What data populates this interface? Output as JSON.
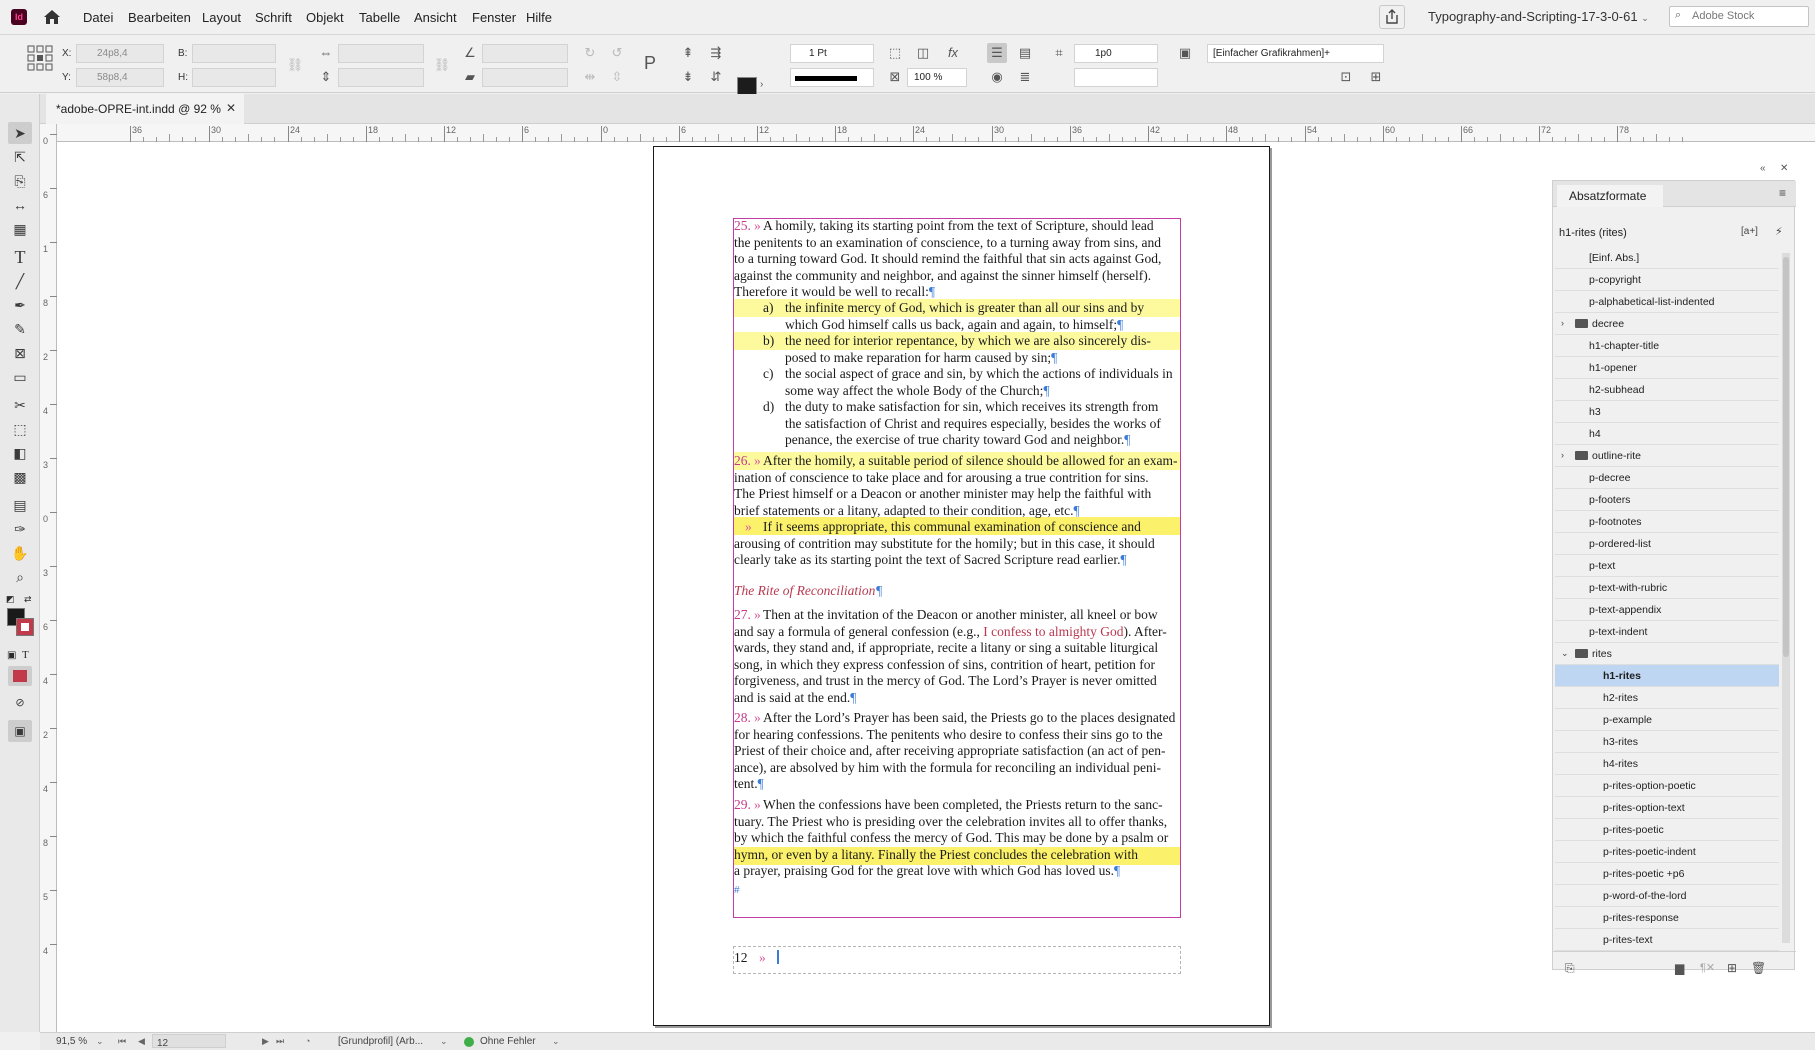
{
  "app": {
    "logo": "Id",
    "home_icon": "home-icon"
  },
  "menu": [
    "Datei",
    "Bearbeiten",
    "Layout",
    "Schrift",
    "Objekt",
    "Tabelle",
    "Ansicht",
    "Fenster",
    "Hilfe"
  ],
  "header": {
    "document_title": "Typography-and-Scripting-17-3-0-61",
    "stock_placeholder": "Adobe Stock"
  },
  "control": {
    "x_label": "X:",
    "x_value": "24p8,4",
    "y_label": "Y:",
    "y_value": "58p8,4",
    "w_label": "B:",
    "h_label": "H:",
    "stroke_weight": "1 Pt",
    "scale": "100 %",
    "spacing": "1p0",
    "object_style": "[Einfacher Grafikrahmen]+"
  },
  "tab": {
    "label": "*adobe-OPRE-int.indd @ 92 %"
  },
  "ruler": {
    "h_ticks": [
      "36",
      "30",
      "24",
      "18",
      "12",
      "6",
      "0",
      "6",
      "12",
      "18",
      "24",
      "30",
      "36",
      "42",
      "48",
      "54",
      "60",
      "66",
      "72",
      "78"
    ],
    "v_ticks": [
      "0",
      "6",
      "1",
      "8",
      "2",
      "4",
      "3",
      "0",
      "3",
      "6",
      "4",
      "2",
      "4",
      "8",
      "5",
      "4"
    ]
  },
  "document": {
    "p25_num": "25.",
    "p25_lines": [
      "A homily, taking its starting point from the text of Scripture, should lead",
      "the penitents to an examination of conscience, to a turning away from sins, and",
      "to a turning toward God. It should remind the faithful that sin acts against God,",
      "against the community and neighbor, and against the sinner himself (herself).",
      "Therefore it would be well to recall:"
    ],
    "list": [
      {
        "letter": "a)",
        "lines": [
          "the infinite mercy of God, which is greater than all our sins and by",
          "which God himself calls us back, again and again, to himself;"
        ]
      },
      {
        "letter": "b)",
        "lines": [
          "the need for interior repentance, by which we are also sincerely dis-",
          "posed to make reparation for harm caused by sin;"
        ]
      },
      {
        "letter": "c)",
        "lines": [
          "the social aspect of grace and sin, by which the actions of individuals in",
          "some way affect the whole Body of the Church;"
        ]
      },
      {
        "letter": "d)",
        "lines": [
          "the duty to make satisfaction for sin, which receives its strength from",
          "the satisfaction of Christ and requires especially, besides the works of",
          "penance, the exercise of true charity toward God and neighbor."
        ]
      }
    ],
    "p26_num": "26.",
    "p26_lines": [
      "After the homily, a suitable period of silence should be allowed for an exam-",
      "ination of conscience to take place and for arousing a true contrition for sins.",
      "The Priest himself or a Deacon or another minister may help the faithful with",
      "brief statements or a litany, adapted to their condition, age, etc."
    ],
    "p26b_lines": [
      "If it seems appropriate, this communal examination of conscience and",
      "arousing of contrition may substitute for the homily; but in this case, it should",
      "clearly take as its starting point the text of Sacred Scripture read earlier."
    ],
    "heading": "The Rite of Reconciliation",
    "p27_num": "27.",
    "p27_first": "Then at the invitation of the Deacon or another minister, all kneel or bow",
    "p27_second_a": "and say a formula of general confession (e.g., ",
    "p27_rubric": "I confess to almighty God",
    "p27_second_b": "). After-",
    "p27_lines": [
      "wards, they stand and, if appropriate, recite a litany or sing a suitable liturgical",
      "song, in which they express confession of sins, contrition of heart, petition for",
      "forgiveness, and trust in the mercy of God. The Lord’s Prayer is never omitted",
      "and is said at the end."
    ],
    "p28_num": "28.",
    "p28_lines": [
      "After the Lord’s Prayer has been said, the Priests go to the places designated",
      "for hearing confessions. The penitents who desire to confess their sins go to the",
      "Priest of their choice and, after receiving appropriate satisfaction (an act of pen-",
      "ance), are absolved by him with the formula for reconciling an individual peni-",
      "tent."
    ],
    "p29_num": "29.",
    "p29_lines": [
      "When the confessions have been completed, the Priests return to the sanc-",
      "tuary. The Priest who is presiding over the celebration invites all to offer thanks,",
      "by which the faithful confess the mercy of God. This may be done by a psalm or",
      "hymn, or even by a litany. Finally the Priest concludes the celebration with",
      "a prayer, praising God for the great love with which God has loved us."
    ],
    "pilcrow": "¶",
    "tab_mark": "»",
    "folio": "12"
  },
  "panel": {
    "title": "Absatzformate",
    "current_style": "h1-rites (rites)",
    "items": [
      {
        "label": "[Einf. Abs.]",
        "level": 1
      },
      {
        "label": "p-copyright",
        "level": 1
      },
      {
        "label": "p-alphabetical-list-indented",
        "level": 1
      },
      {
        "label": "decree",
        "level": 0,
        "folder": true,
        "open": false
      },
      {
        "label": "h1-chapter-title",
        "level": 1
      },
      {
        "label": "h1-opener",
        "level": 1
      },
      {
        "label": "h2-subhead",
        "level": 1
      },
      {
        "label": "h3",
        "level": 1
      },
      {
        "label": "h4",
        "level": 1
      },
      {
        "label": "outline-rite",
        "level": 0,
        "folder": true,
        "open": false
      },
      {
        "label": "p-decree",
        "level": 1
      },
      {
        "label": "p-footers",
        "level": 1
      },
      {
        "label": "p-footnotes",
        "level": 1
      },
      {
        "label": "p-ordered-list",
        "level": 1
      },
      {
        "label": "p-text",
        "level": 1
      },
      {
        "label": "p-text-with-rubric",
        "level": 1
      },
      {
        "label": "p-text-appendix",
        "level": 1
      },
      {
        "label": "p-text-indent",
        "level": 1
      },
      {
        "label": "rites",
        "level": 0,
        "folder": true,
        "open": true
      },
      {
        "label": "h1-rites",
        "level": 2,
        "selected": true
      },
      {
        "label": "h2-rites",
        "level": 2
      },
      {
        "label": "p-example",
        "level": 2
      },
      {
        "label": "h3-rites",
        "level": 2
      },
      {
        "label": "h4-rites",
        "level": 2
      },
      {
        "label": "p-rites-option-poetic",
        "level": 2
      },
      {
        "label": "p-rites-option-text",
        "level": 2
      },
      {
        "label": "p-rites-poetic",
        "level": 2
      },
      {
        "label": "p-rites-poetic-indent",
        "level": 2
      },
      {
        "label": "p-rites-poetic +p6",
        "level": 2
      },
      {
        "label": "p-word-of-the-lord",
        "level": 2
      },
      {
        "label": "p-rites-response",
        "level": 2
      },
      {
        "label": "p-rites-text",
        "level": 2
      }
    ]
  },
  "status": {
    "zoom": "91,5 %",
    "page": "12",
    "profile": "[Grundprofil] (Arb...",
    "preflight": "Ohne Fehler"
  },
  "colors": {
    "highlight": "#fdfa9e",
    "highlight_strong": "#fbf16a",
    "frame": "#c23ca6",
    "rubric": "#b8394f",
    "selection": "#bfd6f3"
  }
}
